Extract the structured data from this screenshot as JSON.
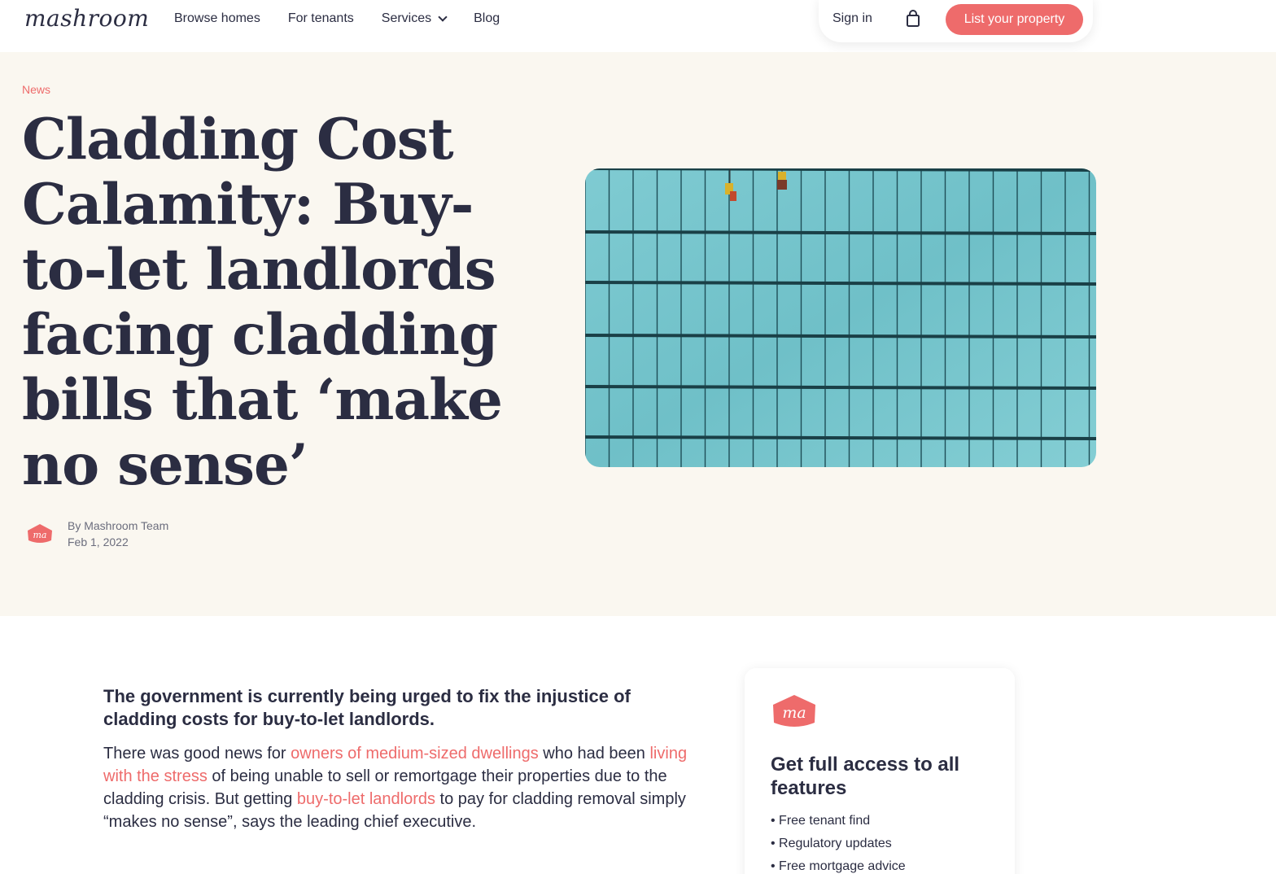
{
  "header": {
    "logo": "mashroom",
    "nav": [
      {
        "label": "Browse homes"
      },
      {
        "label": "For tenants"
      },
      {
        "label": "Services"
      },
      {
        "label": "Blog"
      }
    ],
    "sign_in": "Sign in",
    "cta": "List your property"
  },
  "hero": {
    "category": "News",
    "title": "Cladding Cost Calamity: Buy-to-let landlords facing cladding bills that ‘make no sense’",
    "author": "By Mashroom Team",
    "date": "Feb 1, 2022",
    "avatar_text": "ma"
  },
  "article": {
    "lead": "The government is currently being urged to fix the injustice of cladding costs for buy-to-let landlords.",
    "p1": {
      "t1": "There was good news for ",
      "link1": "owners of medium-sized dwellings",
      "t2": " who had been ",
      "link2": "living with the stress",
      "t3": " of being unable to sell or remortgage their properties due to the cladding crisis. But getting ",
      "link3": "buy-to-let landlords",
      "t4": " to pay for cladding removal simply “makes no sense”, says the leading chief executive."
    }
  },
  "sidebar": {
    "logo_text": "ma",
    "title": "Get full access to all features",
    "items": [
      "• Free tenant find",
      "• Regulatory updates",
      "• Free mortgage advice"
    ]
  },
  "colors": {
    "accent": "#ee6b6b",
    "text": "#2b2d42",
    "hero_bg": "#faf7f0"
  }
}
